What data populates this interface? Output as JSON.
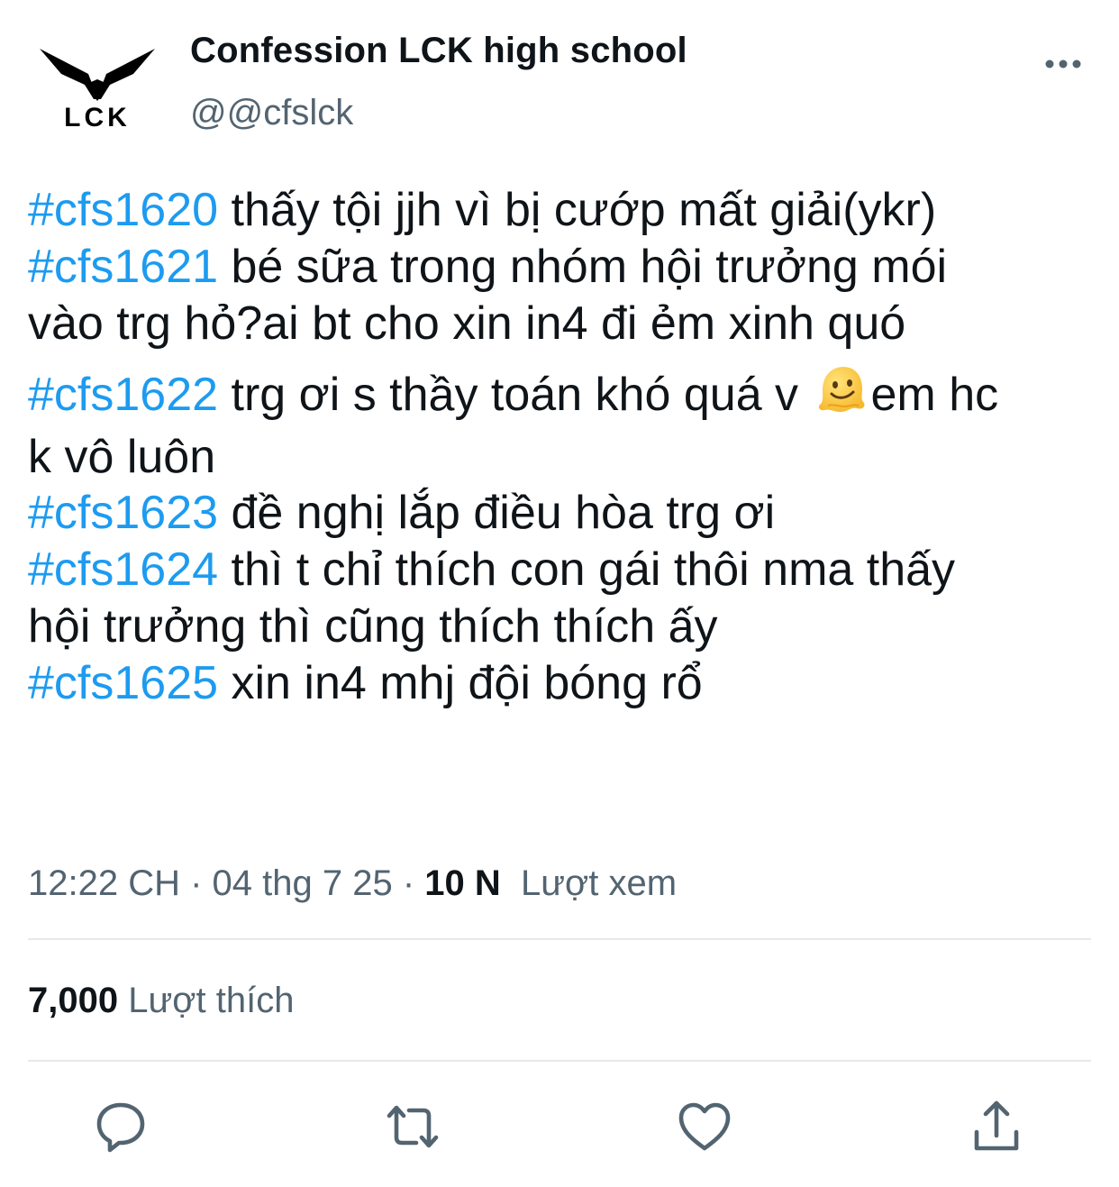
{
  "profile": {
    "name": "Confession LCK high school",
    "handle": "@@cfslck",
    "avatar_icon": "lck-logo-icon",
    "avatar_text": "LCK"
  },
  "tweet": {
    "lines": [
      {
        "tag": "#cfs1620",
        "text": " thấy tội jjh vì bị cướp mất giải(ykr)"
      },
      {
        "tag": "#cfs1621",
        "text": " bé sữa trong nhóm hội trưởng mói"
      },
      {
        "tag": "",
        "text": "vào trg hỏ?ai bt cho xin in4 đi ẻm xinh quó"
      },
      {
        "tag": "#cfs1622",
        "text": " trg ơi s thầy toán khó quá v ",
        "emoji": "melting-face-emoji",
        "after": "em hc"
      },
      {
        "tag": "",
        "text": "k vô luôn"
      },
      {
        "tag": "#cfs1623",
        "text": " đề nghị lắp điều hòa trg ơi"
      },
      {
        "tag": "#cfs1624",
        "text": " thì t chỉ thích con gái thôi nma thấy"
      },
      {
        "tag": "",
        "text": "hội trưởng thì cũng thích thích ấy"
      },
      {
        "tag": "#cfs1625",
        "text": " xin in4 mhj đội bóng rổ"
      }
    ]
  },
  "meta": {
    "time": "12:22 CH",
    "sep1": " · ",
    "date": "04 thg 7 25",
    "sep2": " · ",
    "views_count": "10 N",
    "views_label": "Lượt xem"
  },
  "stats": {
    "likes_count": "7,000",
    "likes_label": "Lượt thích"
  },
  "actions": [
    "reply-icon",
    "retweet-icon",
    "like-icon",
    "share-icon"
  ],
  "colors": {
    "hashtag": "#1d9bf0",
    "secondary_text": "#536471",
    "primary_text": "#0f1419",
    "divider": "#e6e9eb"
  }
}
